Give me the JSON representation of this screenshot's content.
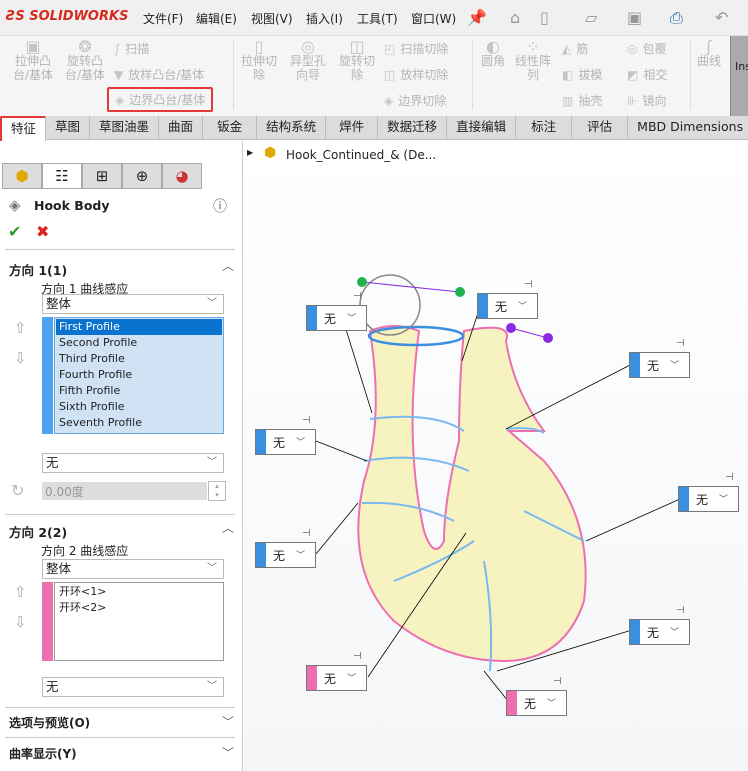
{
  "app": {
    "logo": "SOLIDWORKS",
    "menu": [
      "文件(F)",
      "编辑(E)",
      "视图(V)",
      "插入(I)",
      "工具(T)",
      "窗口(W)"
    ]
  },
  "ribbon": {
    "big": [
      "拉伸凸台/基体",
      "旋转凸台/基体",
      "拉伸切除",
      "异型孔向导",
      "旋转切除",
      "圆角",
      "线性阵列",
      "曲线"
    ],
    "small": [
      "扫描",
      "放样凸台/基体",
      "边界凸台/基体",
      "扫描切除",
      "放样切除",
      "边界切除",
      "筋",
      "拔模",
      "抽壳",
      "包覆",
      "相交",
      "镜向"
    ],
    "ins": "Ins"
  },
  "tabs": [
    "特征",
    "草图",
    "草图油墨",
    "曲面",
    "钣金",
    "结构系统",
    "焊件",
    "数据迁移",
    "直接编辑",
    "标注",
    "评估",
    "MBD Dimensions"
  ],
  "panel": {
    "title": "Hook Body",
    "dir1": {
      "header": "方向 1(1)",
      "label": "方向 1 曲线感应",
      "mode": "整体",
      "profiles": [
        "First Profile",
        "Second Profile",
        "Third Profile",
        "Fourth Profile",
        "Fifth Profile",
        "Sixth Profile",
        "Seventh Profile"
      ],
      "selected": 0,
      "tangent": "无",
      "angle": "0.00度"
    },
    "dir2": {
      "header": "方向 2(2)",
      "label": "方向 2 曲线感应",
      "mode": "整体",
      "items": [
        "开环<1>",
        "开环<2>"
      ],
      "tangent": "无"
    },
    "options": "选项与预览(O)",
    "curvature": "曲率显示(Y)"
  },
  "view": {
    "tree_item": "Hook_Continued_& (De...",
    "callout": "无",
    "blue": "#3b8fe0",
    "pink": "#ee6fb0"
  }
}
